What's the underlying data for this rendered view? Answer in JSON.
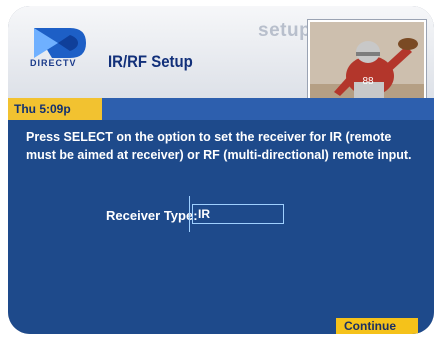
{
  "brand": {
    "logo_text": "DIRECTV"
  },
  "header": {
    "title": "IR/RF Setup",
    "section": "setup",
    "date_time": "Thu 5:09p"
  },
  "main": {
    "instruction": "Press SELECT on the option to set the receiver for IR (remote must be aimed at receiver) or RF (multi-directional) remote input.",
    "receiver_type": {
      "label": "Receiver Type:",
      "value": "IR"
    },
    "continue_label": "Continue"
  },
  "colors": {
    "accent_yellow": "#f5c21a",
    "content_blue": "#1e4a8b",
    "date_bar_blue": "#2d5fae",
    "title_navy": "#12307a"
  },
  "icons": {
    "logo": "directv-logo-icon"
  }
}
